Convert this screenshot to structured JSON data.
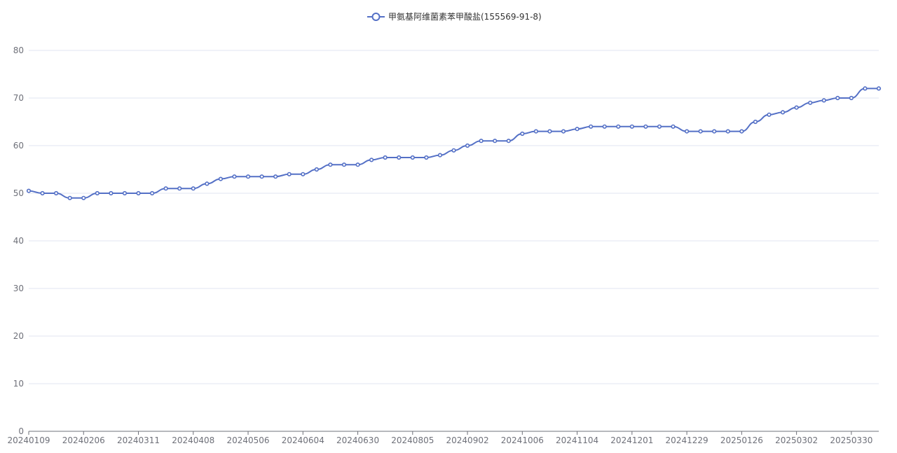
{
  "chart_data": {
    "type": "line",
    "title": "",
    "xlabel": "",
    "ylabel": "",
    "legend_position": "top-center",
    "grid": true,
    "ylim": [
      0,
      80
    ],
    "y_ticks": [
      0,
      10,
      20,
      30,
      40,
      50,
      60,
      70,
      80
    ],
    "x_tick_labels": [
      "20240109",
      "20240206",
      "20240311",
      "20240408",
      "20240506",
      "20240604",
      "20240630",
      "20240805",
      "20240902",
      "20241006",
      "20241104",
      "20241201",
      "20241229",
      "20250126",
      "20250302",
      "20250330"
    ],
    "x_tick_every": 4,
    "colors": {
      "series": "#5470c6"
    },
    "series": [
      {
        "name": "甲氨基阿维菌素苯甲酸盐(155569-91-8)",
        "values": [
          50.5,
          50,
          50,
          49,
          49,
          50,
          50,
          50,
          50,
          50,
          51,
          51,
          51,
          52,
          53,
          53.5,
          53.5,
          53.5,
          53.5,
          54,
          54,
          55,
          56,
          56,
          56,
          57,
          57.5,
          57.5,
          57.5,
          57.5,
          58,
          59,
          60,
          61,
          61,
          61,
          62.5,
          63,
          63,
          63,
          63.5,
          64,
          64,
          64,
          64,
          64,
          64,
          64,
          63,
          63,
          63,
          63,
          63,
          65,
          66.5,
          67,
          68,
          69,
          69.5,
          70,
          70,
          72,
          72
        ]
      }
    ]
  }
}
